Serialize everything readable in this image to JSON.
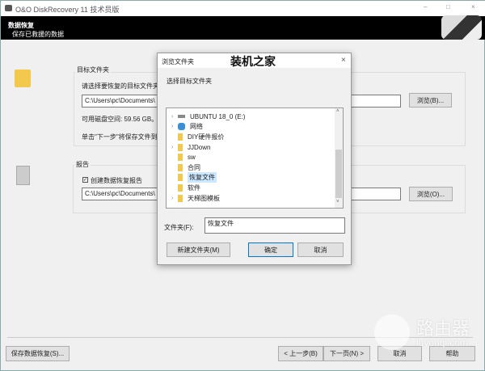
{
  "window": {
    "title": "O&O DiskRecovery 11 技术员版",
    "minimize": "–",
    "maximize": "□",
    "close": "×"
  },
  "banner": {
    "title": "数据恢复",
    "subtitle": "保存已救援的数据"
  },
  "target": {
    "group_label": "目标文件夹",
    "prompt": "请选择要恢复的目标文件夹",
    "path": "C:\\Users\\pc\\Documents\\",
    "free_space": "可用磁盘空间: 59.56 GB。",
    "hint": "单击\"下一步\"将保存文件到",
    "browse": "浏览(B)..."
  },
  "report": {
    "group_label": "报告",
    "checkbox_label": "创建数据恢复报告",
    "checked": true,
    "path": "C:\\Users\\pc\\Documents\\",
    "browse": "浏览(O)..."
  },
  "footer": {
    "save": "保存数据恢复(S)...",
    "back": "< 上一步(B)",
    "next": "下一页(N) >",
    "cancel": "取消",
    "help": "帮助"
  },
  "dialog": {
    "title": "浏览文件夹",
    "watermark": "装机之家",
    "close": "×",
    "instruction": "选择目标文件夹",
    "tree": [
      {
        "label": "UBUNTU 18_0 (E:)",
        "icon": "drive-icon",
        "expandable": true
      },
      {
        "label": "网络",
        "icon": "network-icon",
        "expandable": true
      },
      {
        "label": "DIY硬件报价",
        "icon": "folder-icon",
        "expandable": false
      },
      {
        "label": "JJDown",
        "icon": "folder-icon",
        "expandable": true
      },
      {
        "label": "sw",
        "icon": "folder-icon",
        "expandable": false
      },
      {
        "label": "合同",
        "icon": "folder-icon",
        "expandable": false
      },
      {
        "label": "恢复文件",
        "icon": "folder-icon",
        "expandable": false,
        "selected": true
      },
      {
        "label": "软件",
        "icon": "folder-icon",
        "expandable": false
      },
      {
        "label": "天梯图模板",
        "icon": "folder-icon",
        "expandable": true
      }
    ],
    "folder_label": "文件夹(F):",
    "folder_value": "恢复文件",
    "new_folder": "新建文件夹(M)",
    "ok": "确定",
    "cancel": "取消"
  },
  "site_watermark": {
    "name": "路由器",
    "url": "luyouqi.com"
  }
}
